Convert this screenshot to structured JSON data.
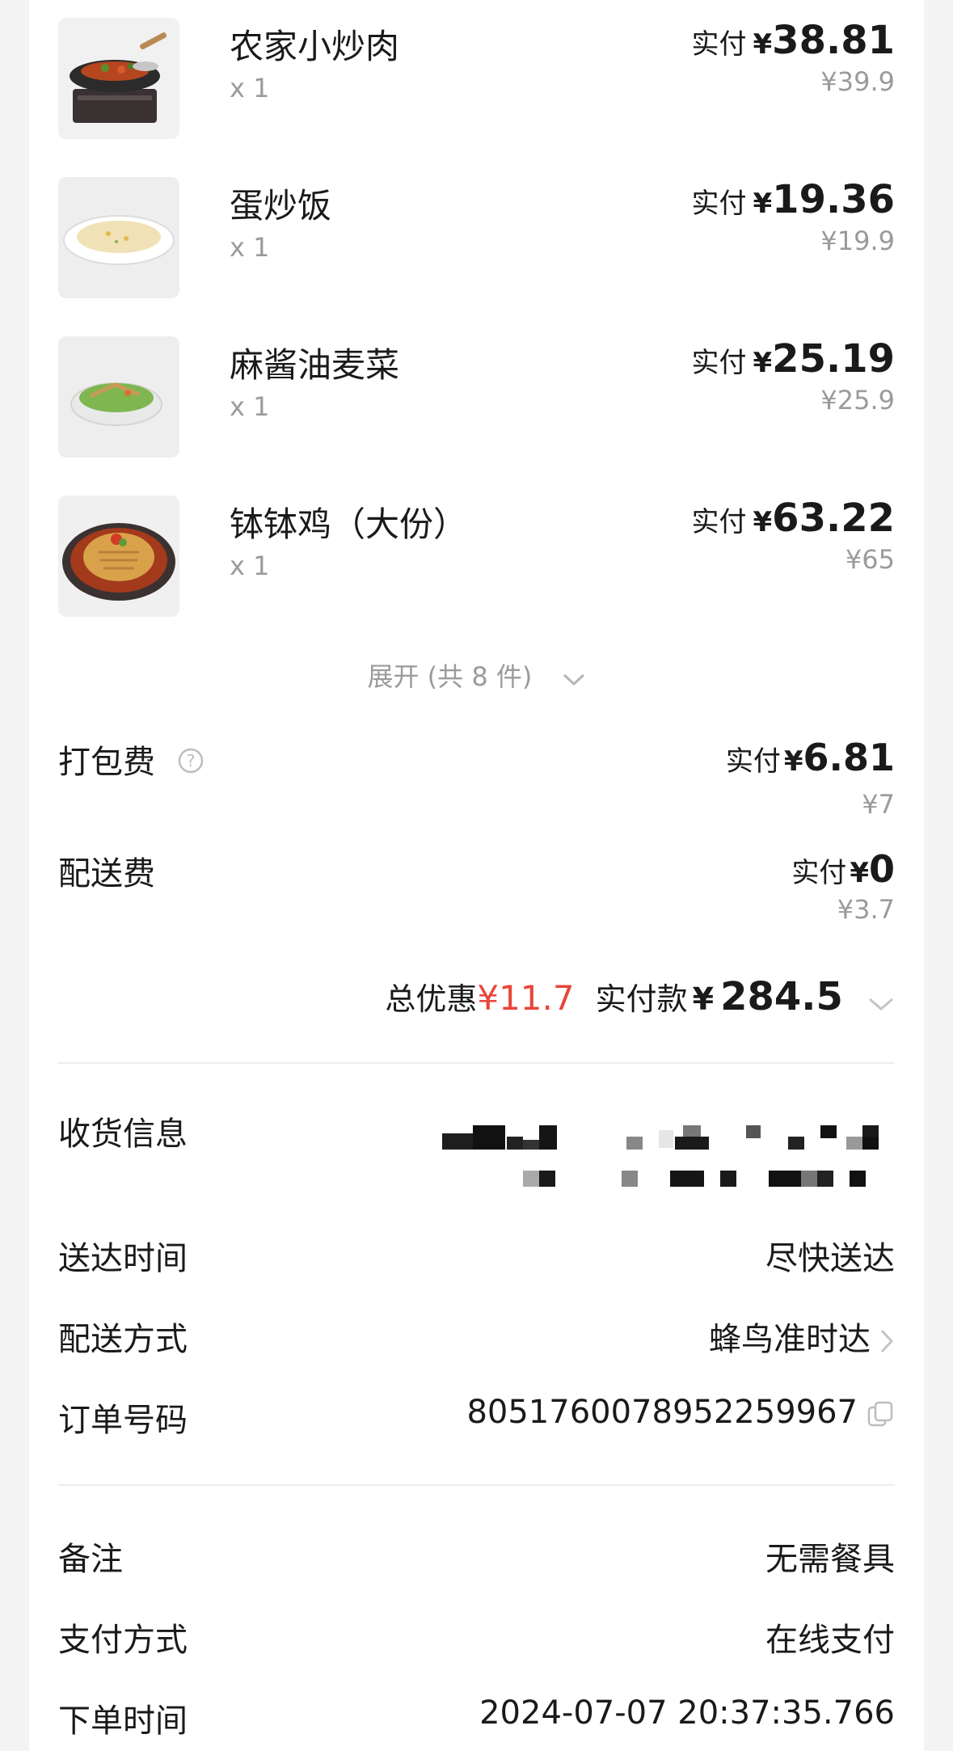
{
  "items": [
    {
      "name": "农家小炒肉",
      "qty": "x 1",
      "paid_label": "实付",
      "yen": "¥",
      "paid": "38.81",
      "original": "¥39.9"
    },
    {
      "name": "蛋炒饭",
      "qty": "x 1",
      "paid_label": "实付",
      "yen": "¥",
      "paid": "19.36",
      "original": "¥19.9"
    },
    {
      "name": "麻酱油麦菜",
      "qty": "x 1",
      "paid_label": "实付",
      "yen": "¥",
      "paid": "25.19",
      "original": "¥25.9"
    },
    {
      "name": "钵钵鸡（大份）",
      "qty": "x 1",
      "paid_label": "实付",
      "yen": "¥",
      "paid": "63.22",
      "original": "¥65"
    }
  ],
  "expand": {
    "label": "展开 (共 8 件)"
  },
  "fees": {
    "packing": {
      "name": "打包费",
      "paid_label": "实付",
      "yen": "¥",
      "paid": "6.81",
      "original": "¥7"
    },
    "delivery": {
      "name": "配送费",
      "paid_label": "实付",
      "yen": "¥",
      "paid": "0",
      "original": "¥3.7"
    }
  },
  "summary": {
    "discount_label": "总优惠",
    "discount_value": "¥11.7",
    "paid_label": "实付款",
    "yen": "¥",
    "paid_total": "284.5"
  },
  "info": {
    "receiver": {
      "label": "收货信息"
    },
    "delivery_time": {
      "label": "送达时间",
      "value": "尽快送达"
    },
    "delivery_method": {
      "label": "配送方式",
      "value": "蜂鸟准时达"
    },
    "order_no": {
      "label": "订单号码",
      "value": "8051760078952259967"
    },
    "note": {
      "label": "备注",
      "value": "无需餐具"
    },
    "payment": {
      "label": "支付方式",
      "value": "在线支付"
    },
    "order_time": {
      "label": "下单时间",
      "value": "2024-07-07 20:37:35.766"
    }
  },
  "colors": {
    "accent_red": "#e8463a",
    "muted": "#9b9b9b",
    "text": "#1a1a1a",
    "background": "#f4f4f4"
  }
}
